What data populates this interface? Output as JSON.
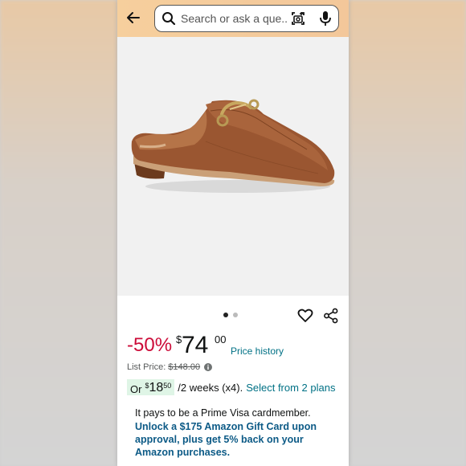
{
  "search": {
    "placeholder": "Search or ask a que..."
  },
  "icons": {
    "back": "back-arrow-icon",
    "search": "search-icon",
    "camera": "camera-scan-icon",
    "mic": "mic-icon",
    "heart": "heart-icon",
    "share": "share-icon",
    "info": "info-icon"
  },
  "colors": {
    "topbar": "#f6cf9d",
    "discount": "#cc0c39",
    "link": "#007185",
    "plan_highlight": "#dff5e6",
    "prime_offer": "#0c5a86",
    "shoe": "#9a5631"
  },
  "carousel": {
    "total": 2,
    "active_index": 0
  },
  "price": {
    "discount": "-50%",
    "currency": "$",
    "whole": "74",
    "fraction": "00",
    "history_link": "Price history"
  },
  "list_price": {
    "label": "List Price:",
    "value": "$148.00"
  },
  "plans": {
    "prefix": "Or",
    "currency": "$",
    "whole": "18",
    "fraction": "50",
    "suffix": "/2 weeks (x4).",
    "link": "Select from 2 plans"
  },
  "prime": {
    "line1": "It pays to be a Prime Visa cardmember.",
    "offer": "Unlock a $175 Amazon Gift Card upon approval, plus get 5% back on your Amazon purchases."
  }
}
